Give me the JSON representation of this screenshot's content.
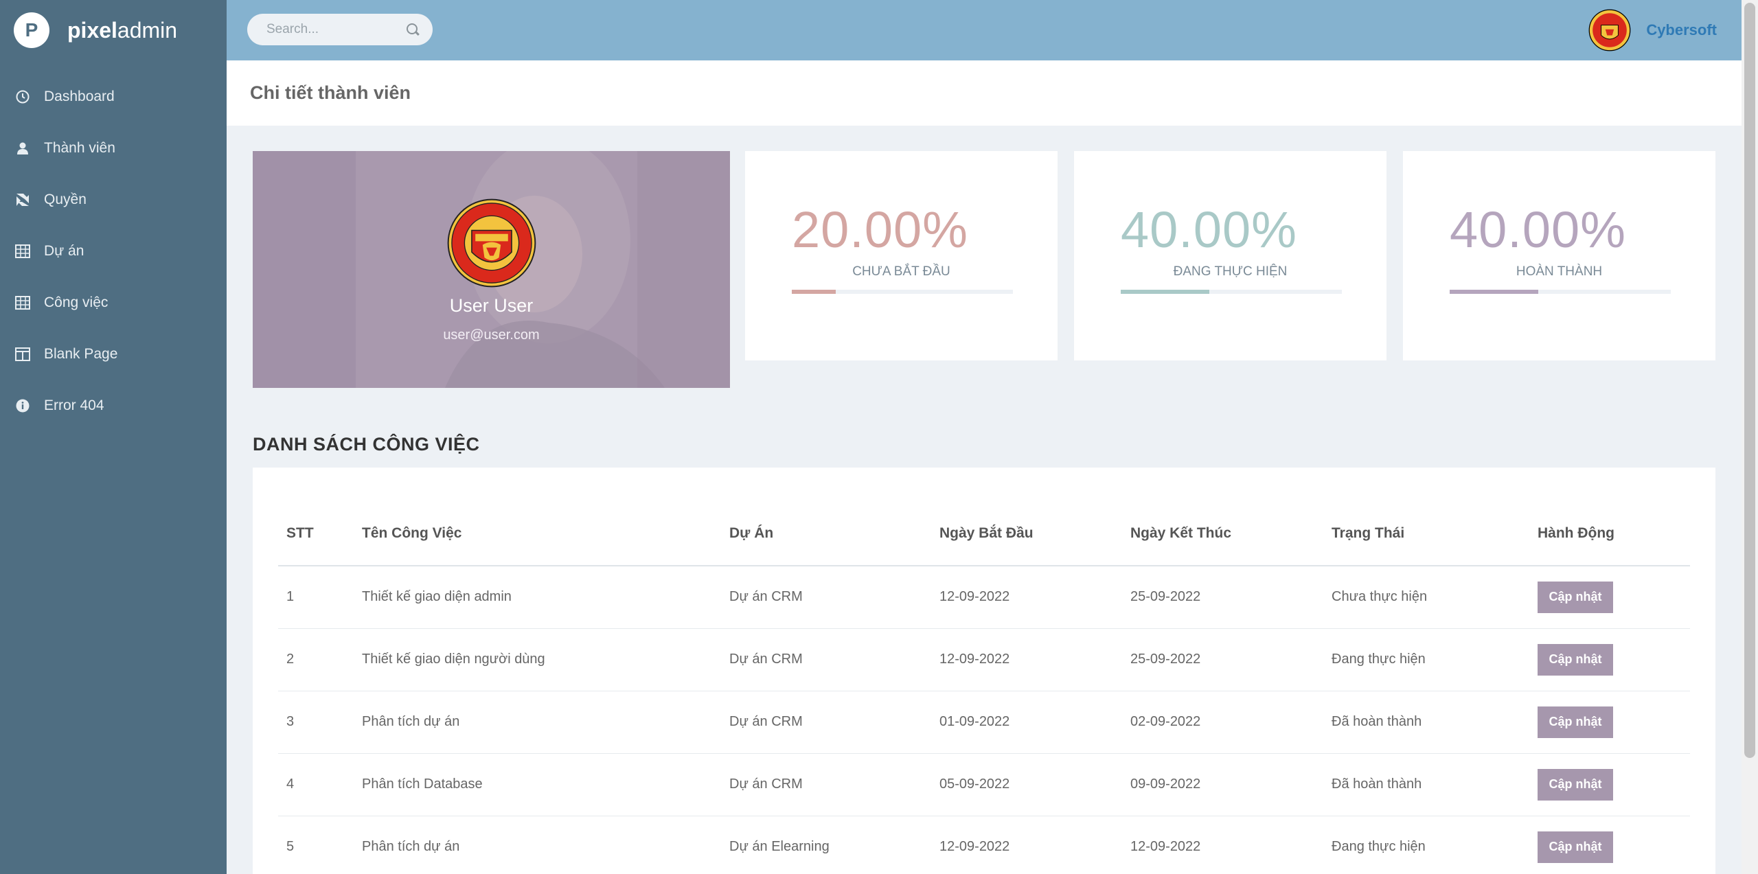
{
  "brand": {
    "letter": "P",
    "bold": "pixel",
    "light": "admin"
  },
  "search": {
    "placeholder": "Search..."
  },
  "user": {
    "name": "Cybersoft"
  },
  "sidebar": {
    "items": [
      {
        "label": "Dashboard",
        "icon": "clock-icon"
      },
      {
        "label": "Thành viên",
        "icon": "user-icon"
      },
      {
        "label": "Quyền",
        "icon": "modx-icon"
      },
      {
        "label": "Dự án",
        "icon": "table-icon"
      },
      {
        "label": "Công việc",
        "icon": "table-icon"
      },
      {
        "label": "Blank Page",
        "icon": "columns-icon"
      },
      {
        "label": "Error 404",
        "icon": "info-circle-icon"
      }
    ]
  },
  "page": {
    "title": "Chi tiết thành viên"
  },
  "profile": {
    "name": "User User",
    "email": "user@user.com"
  },
  "stats": [
    {
      "value": "20.00%",
      "label": "CHƯA BẮT ĐẦU",
      "fill": 0.2,
      "color": "#d4a6a2"
    },
    {
      "value": "40.00%",
      "label": "ĐANG THỰC HIỆN",
      "fill": 0.4,
      "color": "#a9c9c7"
    },
    {
      "value": "40.00%",
      "label": "HOÀN THÀNH",
      "fill": 0.4,
      "color": "#b5a5bd"
    }
  ],
  "tasks": {
    "section_title": "DANH SÁCH CÔNG VIỆC",
    "headers": [
      "STT",
      "Tên Công Việc",
      "Dự Án",
      "Ngày Bắt Đầu",
      "Ngày Kết Thúc",
      "Trạng Thái",
      "Hành Động"
    ],
    "rows": [
      {
        "stt": "1",
        "name": "Thiết kế giao diện admin",
        "project": "Dự án CRM",
        "start": "12-09-2022",
        "end": "25-09-2022",
        "status": "Chưa thực hiện"
      },
      {
        "stt": "2",
        "name": "Thiết kế giao diện người dùng",
        "project": "Dự án CRM",
        "start": "12-09-2022",
        "end": "25-09-2022",
        "status": "Đang thực hiện"
      },
      {
        "stt": "3",
        "name": "Phân tích dự án",
        "project": "Dự án CRM",
        "start": "01-09-2022",
        "end": "02-09-2022",
        "status": "Đã hoàn thành"
      },
      {
        "stt": "4",
        "name": "Phân tích Database",
        "project": "Dự án CRM",
        "start": "05-09-2022",
        "end": "09-09-2022",
        "status": "Đã hoàn thành"
      },
      {
        "stt": "5",
        "name": "Phân tích dự án",
        "project": "Dự án Elearning",
        "start": "12-09-2022",
        "end": "12-09-2022",
        "status": "Đang thực hiện"
      }
    ],
    "action_label": "Cập nhật"
  }
}
